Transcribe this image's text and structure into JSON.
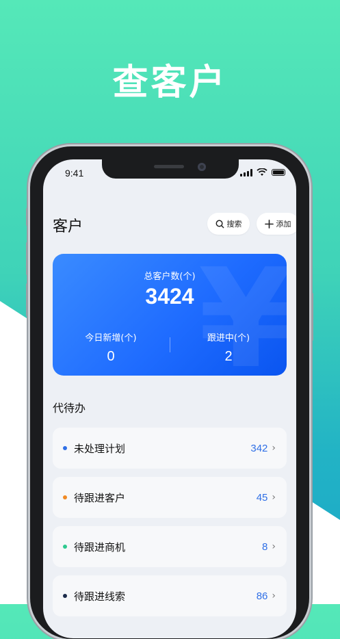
{
  "hero": {
    "title": "查客户"
  },
  "status_bar": {
    "time": "9:41"
  },
  "header": {
    "title": "客户",
    "search_label": "搜索",
    "add_label": "添加"
  },
  "stats": {
    "total_label": "总客户数(个)",
    "total_value": "3424",
    "today_label": "今日新增(个)",
    "today_value": "0",
    "following_label": "跟进中(个)",
    "following_value": "2",
    "watermark": "¥"
  },
  "todo": {
    "title": "代待办",
    "items": [
      {
        "label": "未处理计划",
        "count": "342",
        "dot_color": "#2f6fe6"
      },
      {
        "label": "待跟进客户",
        "count": "45",
        "dot_color": "#f08a24"
      },
      {
        "label": "待跟进商机",
        "count": "8",
        "dot_color": "#2ec98f"
      },
      {
        "label": "待跟进线索",
        "count": "86",
        "dot_color": "#1b2a4a"
      }
    ]
  },
  "colors": {
    "accent": "#2f6fe6",
    "card_start": "#3a8bff",
    "card_end": "#0a55f0"
  }
}
